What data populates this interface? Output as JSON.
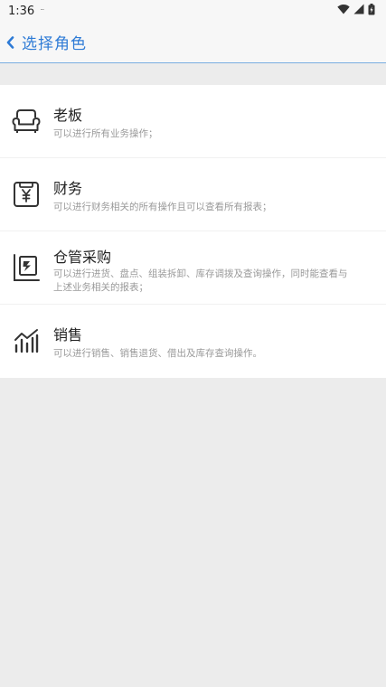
{
  "status": {
    "time": "1:36",
    "notification_text": "ᐧᐧᐧ"
  },
  "header": {
    "back_icon": "chevron-left-icon",
    "title": "选择角色"
  },
  "roles": [
    {
      "icon": "sofa-icon",
      "title": "老板",
      "desc": "可以进行所有业务操作；"
    },
    {
      "icon": "yen-icon",
      "title": "财务",
      "desc": "可以进行财务相关的所有操作且可以查看所有报表；"
    },
    {
      "icon": "warehouse-icon",
      "title": "仓管采购",
      "desc": "可以进行进货、盘点、组装拆卸、库存调拨及查询操作，同时能查看与上述业务相关的报表；"
    },
    {
      "icon": "sales-chart-icon",
      "title": "销售",
      "desc": "可以进行销售、销售退货、借出及库存查询操作。"
    }
  ],
  "colors": {
    "accent": "#2e7bd6",
    "background": "#ececec",
    "card": "#ffffff",
    "icon": "#333333"
  }
}
